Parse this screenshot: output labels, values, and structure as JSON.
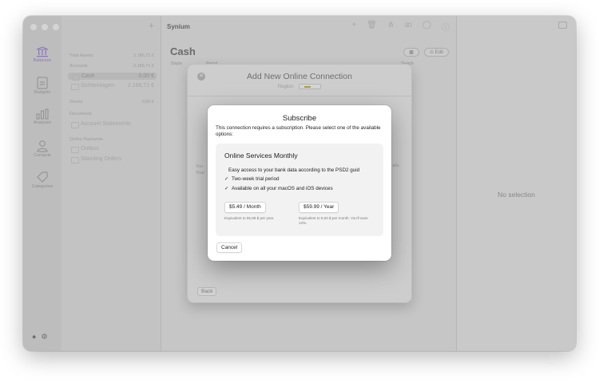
{
  "window": {
    "app_title": "Synium",
    "toolbar_icons": [
      "plus-icon",
      "trash-icon",
      "split-icon",
      "person-icon",
      "bank-icon",
      "help-icon"
    ]
  },
  "sidebar": {
    "items": [
      {
        "label": "Balances",
        "icon": "bank-icon",
        "active": true
      },
      {
        "label": "Budgets",
        "icon": "document-icon",
        "active": false
      },
      {
        "label": "Analyses",
        "icon": "bar-chart-icon",
        "active": false
      },
      {
        "label": "Contacts",
        "icon": "person-icon",
        "active": false
      },
      {
        "label": "Categories",
        "icon": "tag-icon",
        "active": false
      }
    ]
  },
  "accounts": {
    "rows": [
      {
        "kind": "section",
        "name": "Total Assets",
        "value": "2.186,71 €"
      },
      {
        "kind": "section",
        "name": "Accounts",
        "value": "2.186,71 €"
      },
      {
        "kind": "item selected",
        "name": "Cash",
        "value": "0,00 €"
      },
      {
        "kind": "item",
        "name": "Sichteinlagen",
        "value": "2.186,71 €"
      },
      {
        "kind": "section",
        "name": "Stocks",
        "value": "0,00 €"
      },
      {
        "kind": "section",
        "name": "Documents",
        "value": ""
      },
      {
        "kind": "item",
        "name": "Account Statements",
        "value": ""
      },
      {
        "kind": "section",
        "name": "Online Payments",
        "value": ""
      },
      {
        "kind": "item",
        "name": "Outbox",
        "value": ""
      },
      {
        "kind": "item",
        "name": "Standing Orders",
        "value": ""
      }
    ]
  },
  "main": {
    "title": "Cash",
    "edit_label": "Edit",
    "columns": [
      "Displa",
      "Period",
      "Search"
    ]
  },
  "detail": {
    "empty_label": "No selection"
  },
  "sheet": {
    "title": "Add New Online Connection",
    "region_label": "Region:",
    "body_left": "You",
    "body_left_2": "Your",
    "body_right": "ails.",
    "back_label": "Back"
  },
  "dialog": {
    "title": "Subscribe",
    "message": "This connection requires a subscription. Please select one of the available options:",
    "plan": {
      "name": "Online Services Monthly",
      "description": "Easy access to your bank data according to the PSD2 guid",
      "features": [
        "Two-week trial period",
        "Available on all your macOS and iOS devices"
      ],
      "check_glyph": "✓"
    },
    "options": [
      {
        "label": "$5.49 / Month",
        "note": "Equivalent to 65,88 $ per year."
      },
      {
        "label": "$59.99 / Year",
        "note": "Equivalent to 5,00 $ per month. You'll save 13%."
      }
    ],
    "cancel_label": "Cancel"
  },
  "colors": {
    "accent_inactive": "#8a77b8",
    "dialog_bg": "#ffffff"
  }
}
